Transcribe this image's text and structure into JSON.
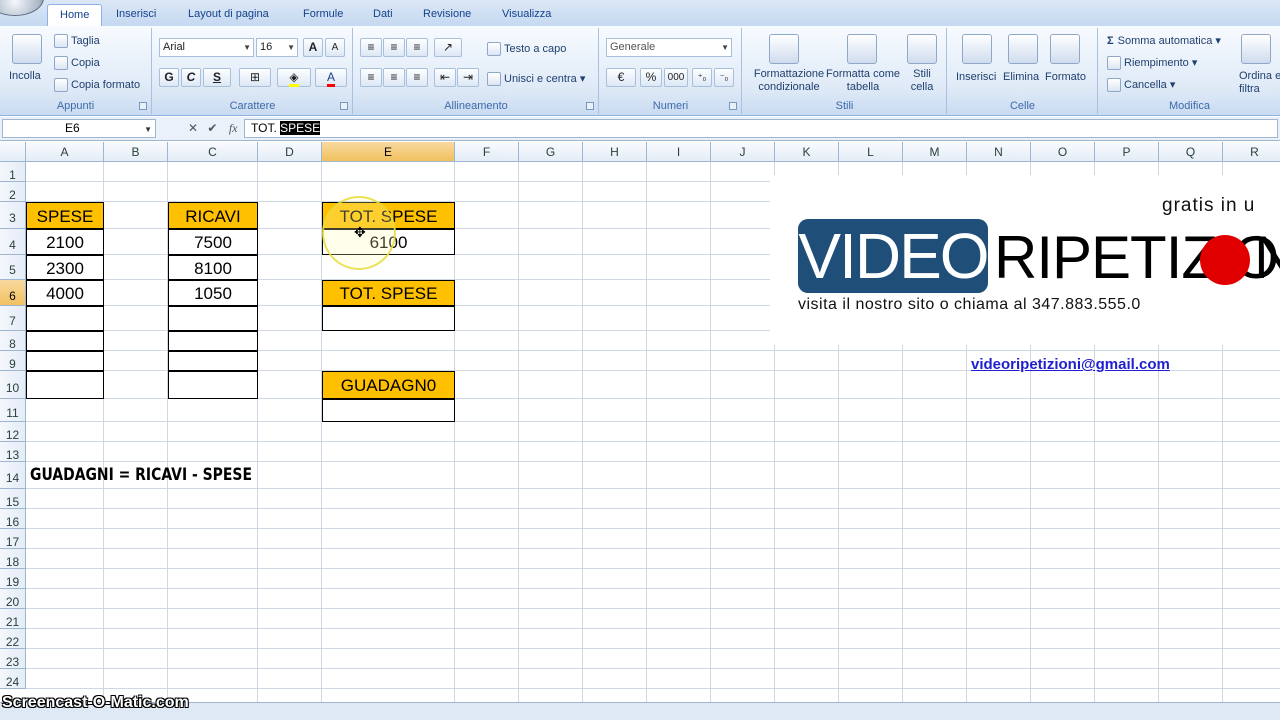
{
  "tabs": [
    "Home",
    "Inserisci",
    "Layout di pagina",
    "Formule",
    "Dati",
    "Revisione",
    "Visualizza"
  ],
  "ribbon": {
    "appunti": {
      "label": "Appunti",
      "paste": "Incolla",
      "cut": "Taglia",
      "copy": "Copia",
      "format_painter": "Copia formato"
    },
    "carattere": {
      "label": "Carattere",
      "font": "Arial",
      "size": "16",
      "bold": "G",
      "italic": "C",
      "underline": "S",
      "grow": "A",
      "shrink": "A",
      "color": "A"
    },
    "allineamento": {
      "label": "Allineamento",
      "wrap": "Testo a capo",
      "merge": "Unisci e centra"
    },
    "numeri": {
      "label": "Numeri",
      "format": "Generale",
      "percent": "%",
      "thousands": "000"
    },
    "stili": {
      "label": "Stili",
      "cond_format": "Formattazione condizionale",
      "table_format": "Formatta come tabella",
      "cell_styles": "Stili cella"
    },
    "celle": {
      "label": "Celle",
      "insert": "Inserisci",
      "delete": "Elimina",
      "format": "Formato"
    },
    "modifica": {
      "label": "Modifica",
      "autosum": "Somma automatica",
      "fill": "Riempimento",
      "clear": "Cancella",
      "sort": "Ordina e filtra"
    }
  },
  "formula_bar": {
    "name_box": "E6",
    "fx": "fx",
    "content_plain": "TOT. ",
    "content_selected": "SPESE"
  },
  "columns": [
    "A",
    "B",
    "C",
    "D",
    "E",
    "F",
    "G",
    "H",
    "I",
    "J",
    "K",
    "L",
    "M",
    "N",
    "O",
    "P",
    "Q",
    "R"
  ],
  "rows": [
    "1",
    "2",
    "3",
    "4",
    "5",
    "6",
    "7",
    "8",
    "9",
    "10",
    "11",
    "12",
    "13",
    "14",
    "15",
    "16",
    "17",
    "18",
    "19",
    "20",
    "21",
    "22",
    "23",
    "24"
  ],
  "cells": {
    "A3": "SPESE",
    "A4": "2100",
    "A5": "2300",
    "A6": "4000",
    "C3": "RICAVI",
    "C4": "7500",
    "C5": "8100",
    "C6": "1050",
    "E3": "TOT. SPESE",
    "E4": "6100",
    "E6": "TOT. SPESE",
    "E10": "GUADAGN0",
    "A14": "GUADAGNI = RICAVI - SPESE"
  },
  "logo": {
    "tagline": "gratis in u",
    "video": "VIDEO",
    "ripetizio": "RIPETIZIO",
    "n": "N",
    "contact": "visita il nostro sito o chiama al 347.883.555.0",
    "email": "videoripetizioni@gmail.com"
  },
  "watermark": "Screencast-O-Matic.com",
  "colors": {
    "header_fill": "#ffc000",
    "logo_blue": "#1f4e79",
    "logo_red": "#e00000"
  }
}
